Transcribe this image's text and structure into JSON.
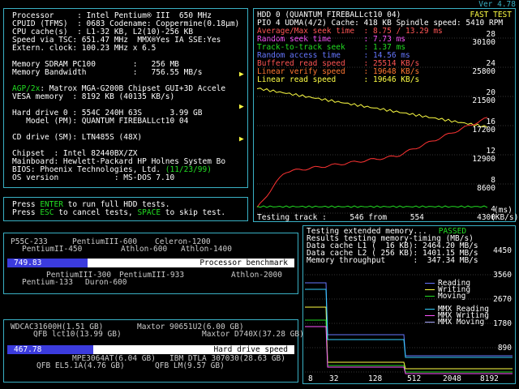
{
  "version": "Ver 4.78",
  "sysinfo": {
    "lines": [
      "Processor     : Intel Pentium® III  650 MHz",
      "CPUID (TFMS)  : 0683 Codename: Coppermine(0.18µm)",
      "CPU cache(s)  : L1-32 KB, L2(10)-256 KB",
      "Speed via TSC: 651.47 MHz  MMX®Yes IA SSE:Yes",
      "Extern. clock: 100.23 MHz x 6.5",
      "",
      "Memory SDRAM PC100        :   256 MB",
      "Memory Bandwidth          :   756.55 MB/s",
      "",
      "AGP/2x: Matrox MGA-G200B Chipset GUI+3D Accele",
      "VESA memory  : 8192 KB (40135 KB/s)",
      "",
      "Hard drive 0 : 554C 240H 63S      3.99 GB",
      "   Model (PM): QUANTUM FIREBALLct10 04",
      "",
      "CD drive (SM): LTN485S (48X)",
      "",
      "Chipset  : Intel 82440BX/ZX",
      "Mainboard: Hewlett-Packard HP Holnes System Bo",
      "BIOS: Phoenix Technologies, Ltd. (11/23/99)",
      "OS version            : MS-DOS 7.10"
    ],
    "agp_prefix": "AGP/2x",
    "bios_date": "(11/23/99)"
  },
  "prompt": {
    "line1_a": "Press ",
    "line1_key": "ENTER",
    "line1_b": " to run full HDD tests.",
    "line2_a": "Press ",
    "line2_key": "ESC",
    "line2_b": " to cancel tests, ",
    "line2_key2": "SPACE",
    "line2_c": " to skip test."
  },
  "hdd": {
    "title": "HDD 0 (QUANTUM FIREBALLct10 04)",
    "fast_test": "FAST TEST",
    "subtitle": "PIO 4 UDMA(4/2) Cache: 418 KB Spindle speed: 5410 RPM",
    "metrics": [
      {
        "label": "Average/Max seek time  :",
        "value": "8.75 / 13.29 ms",
        "color": "#ff5555"
      },
      {
        "label": "Random seek time       :",
        "value": "7.73 ms",
        "color": "#ff55ff"
      },
      {
        "label": "Track-to-track seek    :",
        "value": "1.37 ms",
        "color": "#22dd22"
      },
      {
        "label": "Random access time     :",
        "value": "14.56 ms",
        "color": "#6677ff"
      },
      {
        "label": "Buffered read speed    :",
        "value": "25514 KB/s",
        "color": "#ff5555"
      },
      {
        "label": "Linear verify speed    :",
        "value": "19648 KB/s",
        "color": "#ff7733"
      },
      {
        "label": "Linear read speed      :",
        "value": "19646 KB/s",
        "color": "#ffff44"
      }
    ],
    "yaxis_left": [
      "28",
      "24",
      "20",
      "16",
      "12",
      "8",
      "4"
    ],
    "yaxis_right": [
      "30100",
      "25800",
      "21500",
      "17200",
      "12900",
      "8600",
      "4300"
    ],
    "ms_label": "(ms)",
    "kbs_label": "(KB/s)",
    "footer": "Testing track :     546 from     554"
  },
  "cpu_bench": {
    "top_labels": [
      "P55C-233",
      "PentiumIII-600",
      "Celeron-1200",
      "PentiumII-450",
      "Athlon-600",
      "Athlon-1400"
    ],
    "value": "749.83",
    "caption": "Processor benchmark",
    "bottom_labels": [
      "PentiumIII-300",
      "PentiumIII-933",
      "Athlon-2000",
      "Pentium-133",
      "Duron-600"
    ],
    "fill_fraction": 0.28
  },
  "disk_bench": {
    "top_labels": [
      "WDCAC31600H(1.51 GB)",
      "Maxtor 90651U2(6.00 GB)",
      "QFB lct10(13.99 GB)",
      "Maxtor D740X(37.28 GB)"
    ],
    "value": "467.78",
    "caption": "Hard drive speed",
    "bottom_labels": [
      "MPE3064AT(6.04 GB)",
      "IBM DTLA 307030(28.63 GB)",
      "QFB EL5.1A(4.76 GB)",
      "QFB LM(9.57 GB)"
    ],
    "fill_fraction": 0.3
  },
  "memtest": {
    "line1": "Testing extended memory...",
    "passed": "PASSED",
    "line2": "Results testing memory-timing (MB/s)",
    "line3": "Data cache L1 (  16 KB): 2464.20 MB/s",
    "line4": "Data cache L2 ( 256 KB): 1401.15 MB/s",
    "line5": "Memory throughput      :  347.34 MB/s",
    "yaxis": [
      "4450",
      "3560",
      "2670",
      "1780",
      "890"
    ],
    "xaxis": [
      "8",
      "32",
      "128",
      "512",
      "2048",
      "8192"
    ],
    "legend": [
      {
        "label": "Reading",
        "color": "#6677ff"
      },
      {
        "label": "Writing",
        "color": "#ffff44"
      },
      {
        "label": "Moving",
        "color": "#22dd22"
      },
      {
        "label": "MMX Reading",
        "color": "#33d0ff"
      },
      {
        "label": "MMX Writing",
        "color": "#ff55ff"
      },
      {
        "label": "MMX Moving",
        "color": "#aaaaff"
      }
    ]
  }
}
